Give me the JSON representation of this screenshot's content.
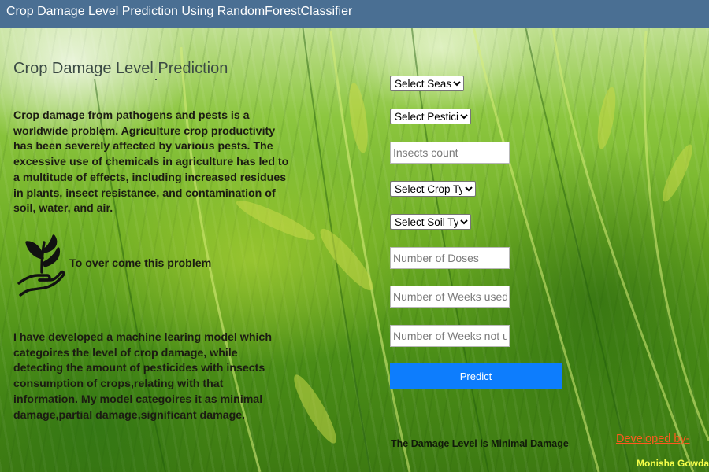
{
  "header": {
    "title": "Crop Damage Level Prediction Using RandomForestClassifier"
  },
  "main": {
    "page_title": "Crop Damage Level Prediction",
    "intro": "Crop damage from pathogens and pests is a worldwide problem. Agriculture crop productivity has been severely affected by various pests. The excessive use of chemicals in agriculture has led to a multitude of effects, including increased residues in plants, insect resistance, and contamination of soil, water, and air.",
    "problem_text": "To over come this problem",
    "description": "I have developed a machine learing model which categoires the level of crop damage, while detecting the amount of pesticides with insects consumption of crops,relating with that information. My model categoires it as minimal damage,partial damage,significant damage.",
    "icon": "hand-plant-icon"
  },
  "form": {
    "season": {
      "selected": "Select Season"
    },
    "pesticide": {
      "selected": "Select Pesticide"
    },
    "insects_count": {
      "placeholder": "Insects count"
    },
    "crop_type": {
      "selected": "Select Crop Type"
    },
    "soil_type": {
      "selected": "Select Soil Type"
    },
    "doses": {
      "placeholder": "Number of Doses"
    },
    "weeks_used": {
      "placeholder": "Number of Weeks used"
    },
    "weeks_not_used": {
      "placeholder": "Number of Weeks not used"
    },
    "predict_label": "Predict"
  },
  "result_text": "The Damage Level is Minimal Damage",
  "footer": {
    "developed_by": "Developed by-",
    "developer": "Monisha Gowda M"
  },
  "colors": {
    "header_bg": "#4a6f93",
    "button_bg": "#0d7dfd",
    "link": "#ff5a1f",
    "developer_name": "#f7ff4a"
  }
}
